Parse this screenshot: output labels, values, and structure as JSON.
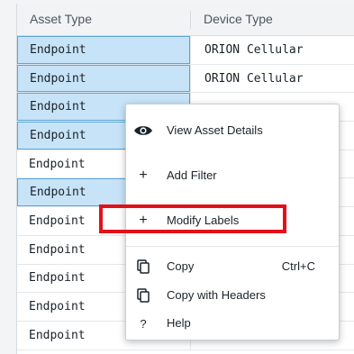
{
  "grid": {
    "columns": [
      "Asset Type",
      "Device Type"
    ],
    "rows": [
      {
        "asset_type": "Endpoint",
        "device_type": "ORION Cellular",
        "selected": true
      },
      {
        "asset_type": "Endpoint",
        "device_type": "ORION Cellular",
        "selected": true
      },
      {
        "asset_type": "Endpoint",
        "device_type": "",
        "selected": true
      },
      {
        "asset_type": "Endpoint",
        "device_type": "",
        "selected": true
      },
      {
        "asset_type": "Endpoint",
        "device_type": "",
        "selected": false
      },
      {
        "asset_type": "Endpoint",
        "device_type": "",
        "selected": true
      },
      {
        "asset_type": "Endpoint",
        "device_type": "",
        "selected": false
      },
      {
        "asset_type": "Endpoint",
        "device_type": "",
        "selected": false
      },
      {
        "asset_type": "Endpoint",
        "device_type": "",
        "selected": false
      },
      {
        "asset_type": "Endpoint",
        "device_type": "",
        "selected": false
      },
      {
        "asset_type": "Endpoint",
        "device_type": "",
        "selected": false
      }
    ]
  },
  "context_menu": {
    "items": [
      {
        "label": "View Asset Details",
        "icon": "eye-icon"
      },
      {
        "label": "Add Filter",
        "icon": "plus-icon"
      },
      {
        "label": "Modify Labels",
        "icon": "plus-icon"
      },
      {
        "label": "Copy",
        "icon": "copy-icon",
        "shortcut": "Ctrl+C"
      },
      {
        "label": "Copy with Headers",
        "icon": "copy-icon"
      },
      {
        "label": "Help",
        "icon": "question-icon"
      }
    ]
  },
  "colors": {
    "selection_fill": "#c7e3f7",
    "selection_border": "#5aa6d8",
    "highlight_box": "#e3101a"
  }
}
